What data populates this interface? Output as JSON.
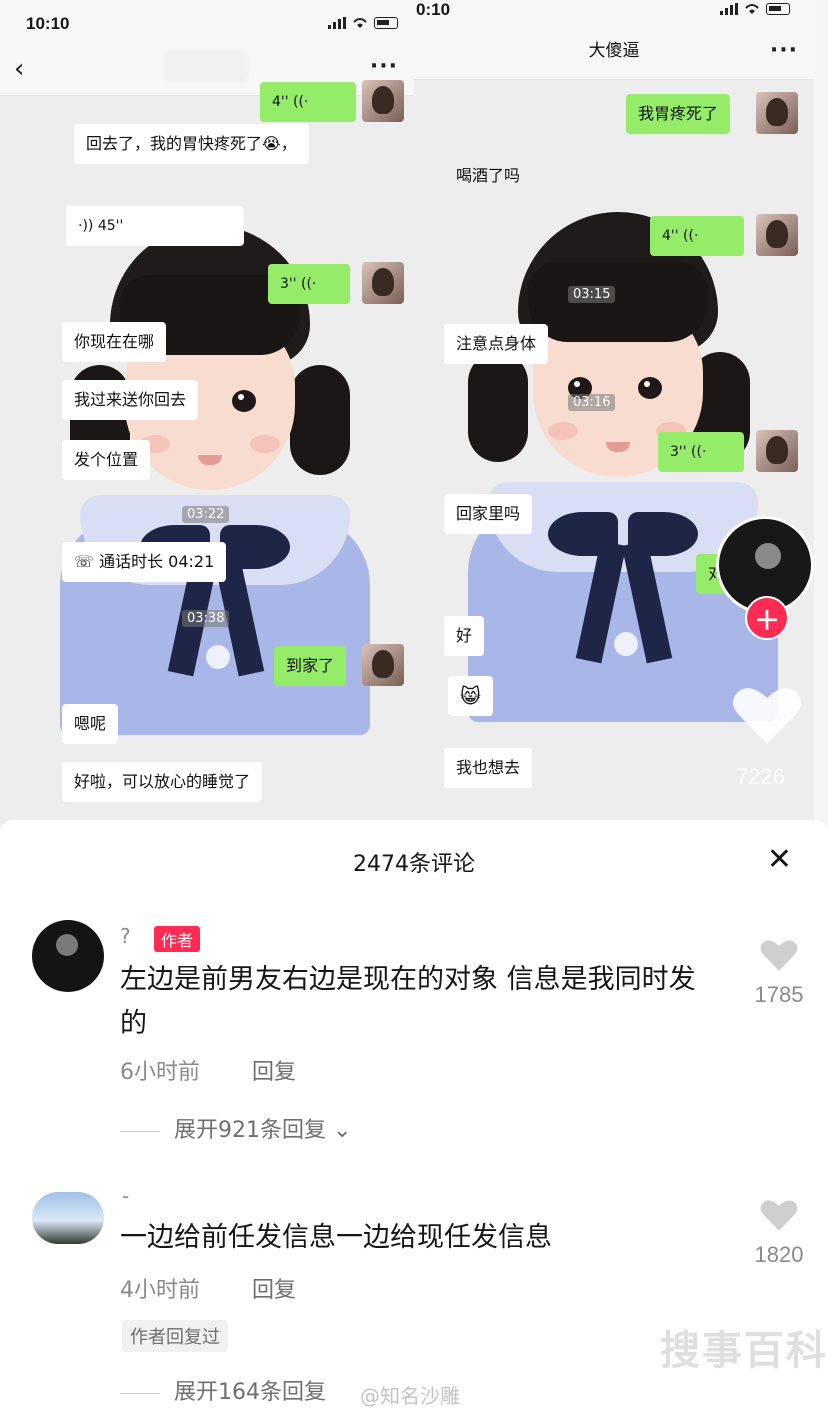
{
  "left_chat": {
    "status_time": "10:10",
    "more": "···",
    "back": "‹",
    "messages": {
      "voice_top": "4''",
      "stomach": "回去了，我的胃快疼死了😭，",
      "voice_45": "·)) 45''",
      "voice_3": "3''",
      "where": "你现在在哪",
      "pickup": "我过来送你回去",
      "location": "发个位置",
      "ts1": "03:22",
      "call": "通话时长 04:21",
      "ts2": "03:38",
      "home": "到家了",
      "ok": "嗯呢",
      "sleep": "好啦，可以放心的睡觉了"
    }
  },
  "right_chat": {
    "status_time": "0:10",
    "title": "大傻逼",
    "more": "···",
    "messages": {
      "stomach": "我胃疼死了",
      "drink": "喝酒了吗",
      "voice_4": "4''",
      "ts1": "03:15",
      "care": "注意点身体",
      "ts2": "03:16",
      "voice_3": "3''",
      "go_home": "回家里吗",
      "cut": "对",
      "fine": "好",
      "emoji": "😸",
      "want": "我也想去"
    },
    "likes": "7226",
    "follow_plus": "+"
  },
  "comments": {
    "title": "2474条评论",
    "close": "✕",
    "items": [
      {
        "name": "?",
        "badge": "作者",
        "text": "左边是前男友右边是现在的对象 信息是我同时发的",
        "time": "6小时前",
        "reply": "回复",
        "expand": "展开921条回复",
        "likes": "1785"
      },
      {
        "name": "-",
        "text": "一边给前任发信息一边给现任发信息",
        "time": "4小时前",
        "reply": "回复",
        "author_replied": "作者回复过",
        "expand": "展开164条回复",
        "likes": "1820"
      }
    ],
    "watermark_text": "@知名沙雕",
    "watermark_logo": "搜事百科"
  },
  "colors": {
    "bubble_green": "#95ec69",
    "accent_red": "#fe2c55",
    "muted": "#8a8a8a"
  }
}
